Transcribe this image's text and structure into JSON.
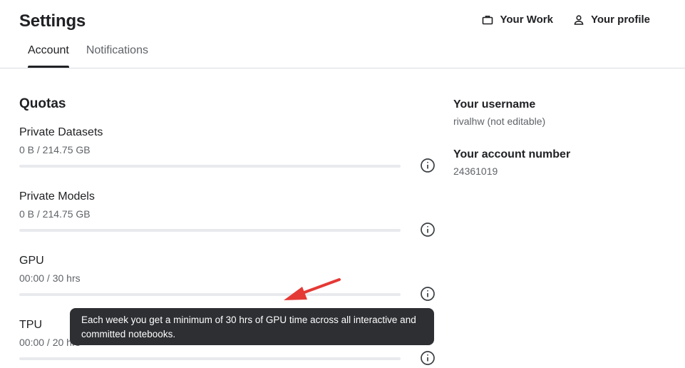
{
  "header": {
    "title": "Settings",
    "links": [
      {
        "label": "Your Work",
        "icon": "briefcase-icon"
      },
      {
        "label": "Your profile",
        "icon": "person-icon"
      }
    ]
  },
  "tabs": [
    {
      "label": "Account",
      "active": true
    },
    {
      "label": "Notifications",
      "active": false
    }
  ],
  "quotas": {
    "title": "Quotas",
    "items": [
      {
        "name": "Private Datasets",
        "value": "0 B / 214.75 GB",
        "used_fraction": 0
      },
      {
        "name": "Private Models",
        "value": "0 B / 214.75 GB",
        "used_fraction": 0
      },
      {
        "name": "GPU",
        "value": "00:00 / 30 hrs",
        "used_fraction": 0
      },
      {
        "name": "TPU",
        "value": "00:00 / 20 hrs",
        "used_fraction": 0
      }
    ]
  },
  "account": {
    "username_label": "Your username",
    "username_value": "rivalhw (not editable)",
    "number_label": "Your account number",
    "number_value": "24361019"
  },
  "tooltip": {
    "text": "Each week you get a minimum of 30 hrs of GPU time across all interactive and committed notebooks."
  },
  "colors": {
    "text": "#202124",
    "muted": "#5f6368",
    "tooltip_bg": "#2e2f33",
    "annotation_arrow": "#e53935"
  }
}
